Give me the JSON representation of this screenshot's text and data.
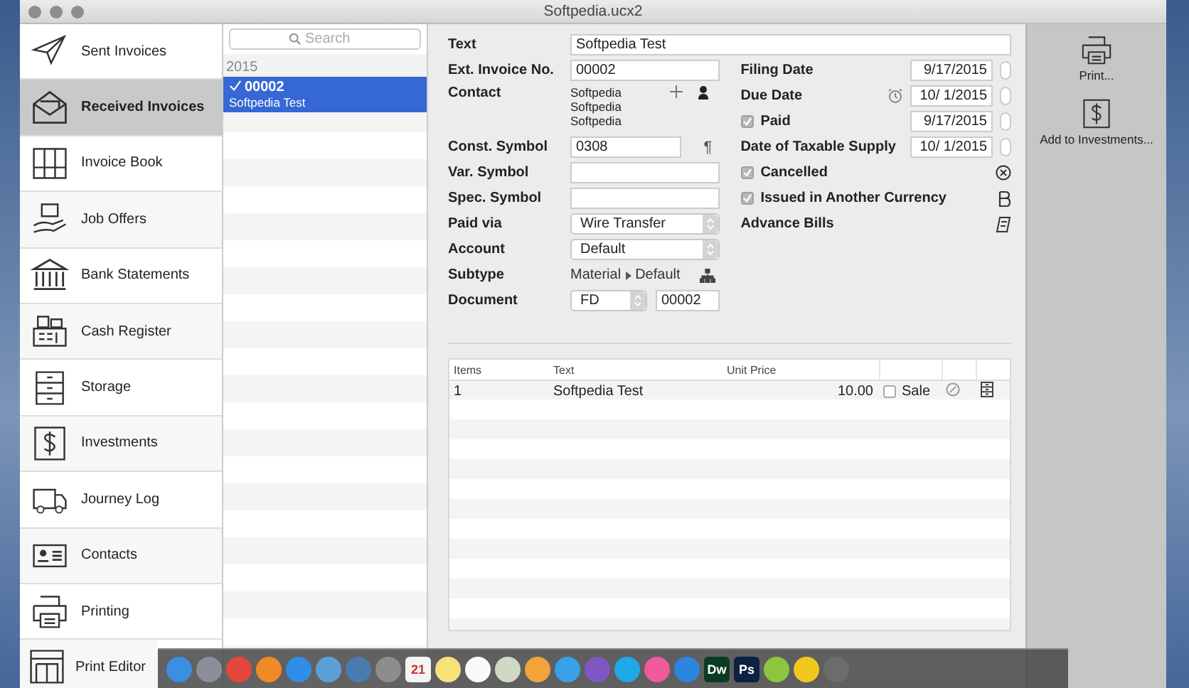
{
  "window": {
    "title": "Softpedia.ucx2"
  },
  "sidebar": {
    "items": [
      {
        "kind": "plane",
        "label": "Sent Invoices",
        "selected": false
      },
      {
        "kind": "envelope",
        "label": "Received Invoices",
        "selected": true
      },
      {
        "kind": "binders",
        "label": "Invoice Book",
        "selected": false
      },
      {
        "kind": "hand",
        "label": "Job Offers",
        "selected": false
      },
      {
        "kind": "bank",
        "label": "Bank Statements",
        "selected": false
      },
      {
        "kind": "register",
        "label": "Cash Register",
        "selected": false
      },
      {
        "kind": "drawers",
        "label": "Storage",
        "selected": false
      },
      {
        "kind": "dollar",
        "label": "Investments",
        "selected": false
      },
      {
        "kind": "truck",
        "label": "Journey Log",
        "selected": false
      },
      {
        "kind": "card",
        "label": "Contacts",
        "selected": false
      },
      {
        "kind": "printer",
        "label": "Printing",
        "selected": false
      },
      {
        "kind": "layout",
        "label": "Print Editor",
        "selected": false
      }
    ]
  },
  "list": {
    "search": {
      "placeholder": "Search"
    },
    "groups": [
      {
        "label": "2015",
        "items": [
          {
            "number": "00002",
            "text": "Softpedia Test",
            "checked": true,
            "selected": true
          }
        ]
      }
    ]
  },
  "form": {
    "text": {
      "label": "Text",
      "value": "Softpedia Test"
    },
    "left_fields": [
      {
        "kind": "input",
        "label": "Ext. Invoice No.",
        "value": "00002"
      },
      {
        "kind": "contact",
        "label": "Contact",
        "lines": [
          "Softpedia",
          "Softpedia",
          "Softpedia"
        ]
      },
      {
        "kind": "input",
        "label": "Const. Symbol",
        "value": "0308",
        "glyph": "¶"
      },
      {
        "kind": "input",
        "label": "Var. Symbol"
      },
      {
        "kind": "input",
        "label": "Spec. Symbol"
      },
      {
        "kind": "select",
        "label": "Paid via",
        "value": "Wire Transfer"
      },
      {
        "kind": "select",
        "label": "Account",
        "value": "Default"
      },
      {
        "kind": "path",
        "label": "Subtype",
        "parts": [
          "Material",
          "Default"
        ]
      },
      {
        "kind": "document",
        "label": "Document",
        "value": "FD",
        "number": "00002"
      }
    ],
    "right_fields": [
      {
        "kind": "date",
        "label": "Filing Date",
        "value": "9/17/2015"
      },
      {
        "kind": "date",
        "label": "Due Date",
        "value": "10/ 1/2015",
        "alarm": true
      },
      {
        "kind": "check_date",
        "label": "Paid",
        "checked": true,
        "value": "9/17/2015"
      },
      {
        "kind": "date",
        "label": "Date of Taxable Supply",
        "value": "10/ 1/2015"
      },
      {
        "kind": "check_cancel",
        "label": "Cancelled",
        "checked": true
      },
      {
        "kind": "check_currency",
        "label": "Issued in Another Currency",
        "checked": true
      },
      {
        "kind": "bills",
        "label": "Advance Bills"
      }
    ]
  },
  "items_table": {
    "columns": [
      "Items",
      "Text",
      "Unit Price"
    ],
    "rows": [
      {
        "items": "1",
        "text": "Softpedia Test",
        "unit_price": "10.00",
        "sale": {
          "label": "Sale",
          "checked": false
        }
      }
    ]
  },
  "toolbar": {
    "buttons": [
      {
        "kind": "printer",
        "label": "Print..."
      },
      {
        "kind": "dollar",
        "label": "Add to Investments..."
      }
    ]
  },
  "dock": {
    "items": [
      {
        "color": "#3b8ee0"
      },
      {
        "color": "#8a8f99"
      },
      {
        "color": "#e4473a"
      },
      {
        "color": "#f08a24"
      },
      {
        "color": "#2f8fe6"
      },
      {
        "color": "#5aa0d8"
      },
      {
        "color": "#4a7bb0"
      },
      {
        "color": "#8d8d8d"
      },
      {
        "color": "#f4f4f4",
        "label": "21"
      },
      {
        "color": "#f7e27a"
      },
      {
        "color": "#fafafa"
      },
      {
        "color": "#cfd9c4"
      },
      {
        "color": "#f2a33a"
      },
      {
        "color": "#3aa0e8"
      },
      {
        "color": "#7e57c2"
      },
      {
        "color": "#1ea8e8"
      },
      {
        "color": "#f05a9a"
      },
      {
        "color": "#2c86e0"
      },
      {
        "color": "#0c3b24",
        "label": "Dw"
      },
      {
        "color": "#0b2240",
        "label": "Ps"
      },
      {
        "color": "#8cc63f"
      },
      {
        "color": "#f2c81e"
      },
      {
        "color": "#6c6c6c"
      }
    ]
  }
}
